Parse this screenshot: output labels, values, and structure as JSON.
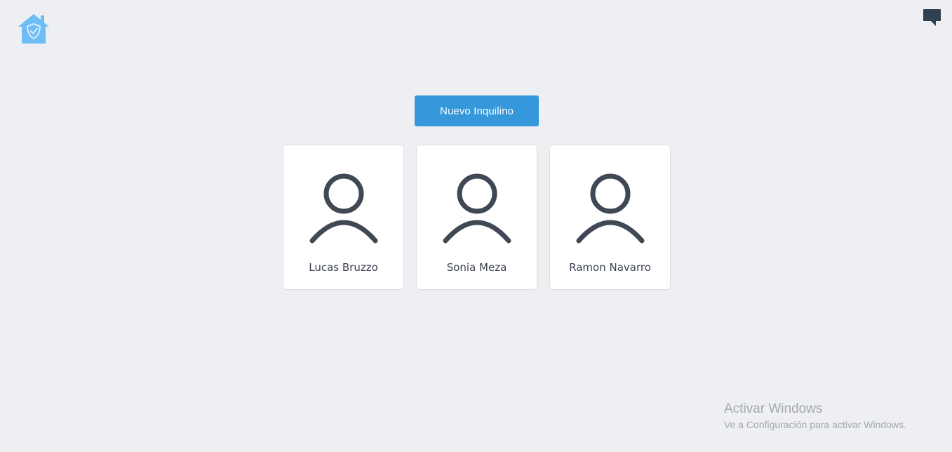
{
  "header": {
    "logo_icon": "house-shield-icon",
    "chat_icon": "chat-bubble-icon"
  },
  "actions": {
    "new_tenant_label": "Nuevo Inquilino"
  },
  "tenants": [
    {
      "name": "Lucas Bruzzo",
      "icon": "user-icon"
    },
    {
      "name": "Sonia Meza",
      "icon": "user-icon"
    },
    {
      "name": "Ramon Navarro",
      "icon": "user-icon"
    }
  ],
  "watermark": {
    "title": "Activar Windows",
    "subtitle": "Ve a Configuración para activar Windows."
  },
  "colors": {
    "background": "#edeff2",
    "primary": "#3498db",
    "logo": "#5db3f0",
    "avatar": "#414855",
    "chat": "#2f4050"
  }
}
